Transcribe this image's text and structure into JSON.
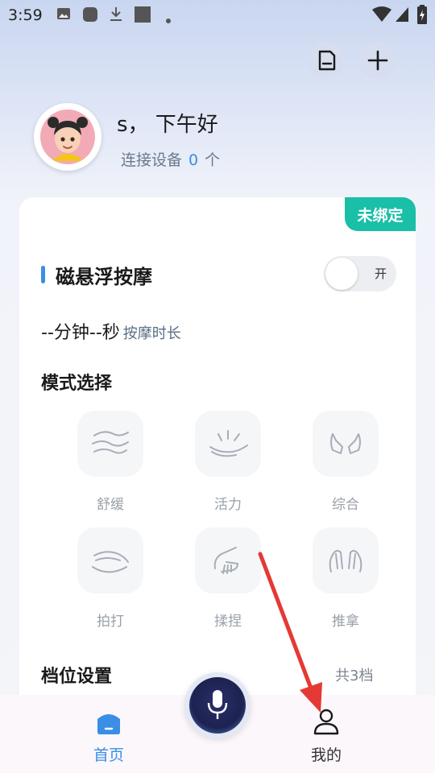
{
  "status_bar": {
    "time": "3:59",
    "icons": [
      "image-icon",
      "app-icon",
      "download-icon",
      "square-icon",
      "dot-icon",
      "wifi-icon",
      "signal-icon",
      "battery-icon"
    ]
  },
  "header": {
    "actions": [
      "document-icon",
      "plus-icon"
    ],
    "greeting": "s， 下午好",
    "devices_label": "连接设备",
    "devices_count": "0",
    "devices_unit": "个"
  },
  "card": {
    "badge": "未绑定",
    "section_title": "磁悬浮按摩",
    "toggle_label": "开",
    "toggle_on": false,
    "duration_value": "--分钟--秒",
    "duration_label": "按摩时长",
    "mode_title": "模式选择",
    "modes": [
      {
        "label": "舒缓",
        "icon": "waves-hand-icon"
      },
      {
        "label": "活力",
        "icon": "palm-icon"
      },
      {
        "label": "综合",
        "icon": "two-hands-icon"
      },
      {
        "label": "拍打",
        "icon": "pat-icon"
      },
      {
        "label": "揉捏",
        "icon": "knead-icon"
      },
      {
        "label": "推拿",
        "icon": "push-icon"
      }
    ],
    "gear_title": "档位设置",
    "gear_count": "共3档"
  },
  "bottom_nav": {
    "home_label": "首页",
    "mine_label": "我的"
  },
  "colors": {
    "accent": "#3a8ee6",
    "badge": "#19bfa6",
    "annotation_arrow": "#e53935"
  }
}
